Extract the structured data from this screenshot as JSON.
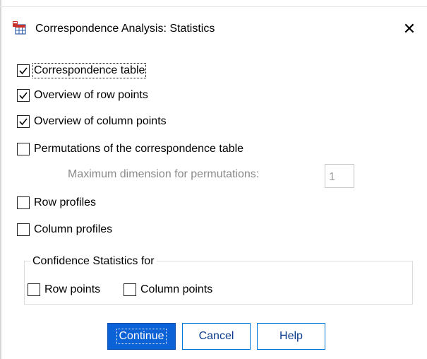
{
  "window": {
    "title": "Correspondence Analysis: Statistics",
    "close_glyph": "✕",
    "icon": "spss-dialog-icon"
  },
  "options": [
    {
      "id": "correspondence-table",
      "label": "Correspondence table",
      "checked": true
    },
    {
      "id": "overview-row-points",
      "label": "Overview of row points",
      "checked": true
    },
    {
      "id": "overview-column-points",
      "label": "Overview of column points",
      "checked": true
    },
    {
      "id": "permutations",
      "label": "Permutations of the correspondence table",
      "checked": false
    },
    {
      "id": "row-profiles",
      "label": "Row profiles",
      "checked": false
    },
    {
      "id": "column-profiles",
      "label": "Column profiles",
      "checked": false
    }
  ],
  "permutations": {
    "max_dimension_label": "Maximum dimension for permutations:",
    "max_dimension_value": "1",
    "enabled": false
  },
  "confidence": {
    "group_title": "Confidence Statistics for",
    "row_points_label": "Row points",
    "row_points_checked": false,
    "column_points_label": "Column points",
    "column_points_checked": false
  },
  "buttons": {
    "continue_label": "Continue",
    "cancel_label": "Cancel",
    "help_label": "Help"
  },
  "colors": {
    "primary_button": "#0b61d6",
    "button_border": "#0078d7",
    "disabled_text": "#8a8a8a"
  }
}
